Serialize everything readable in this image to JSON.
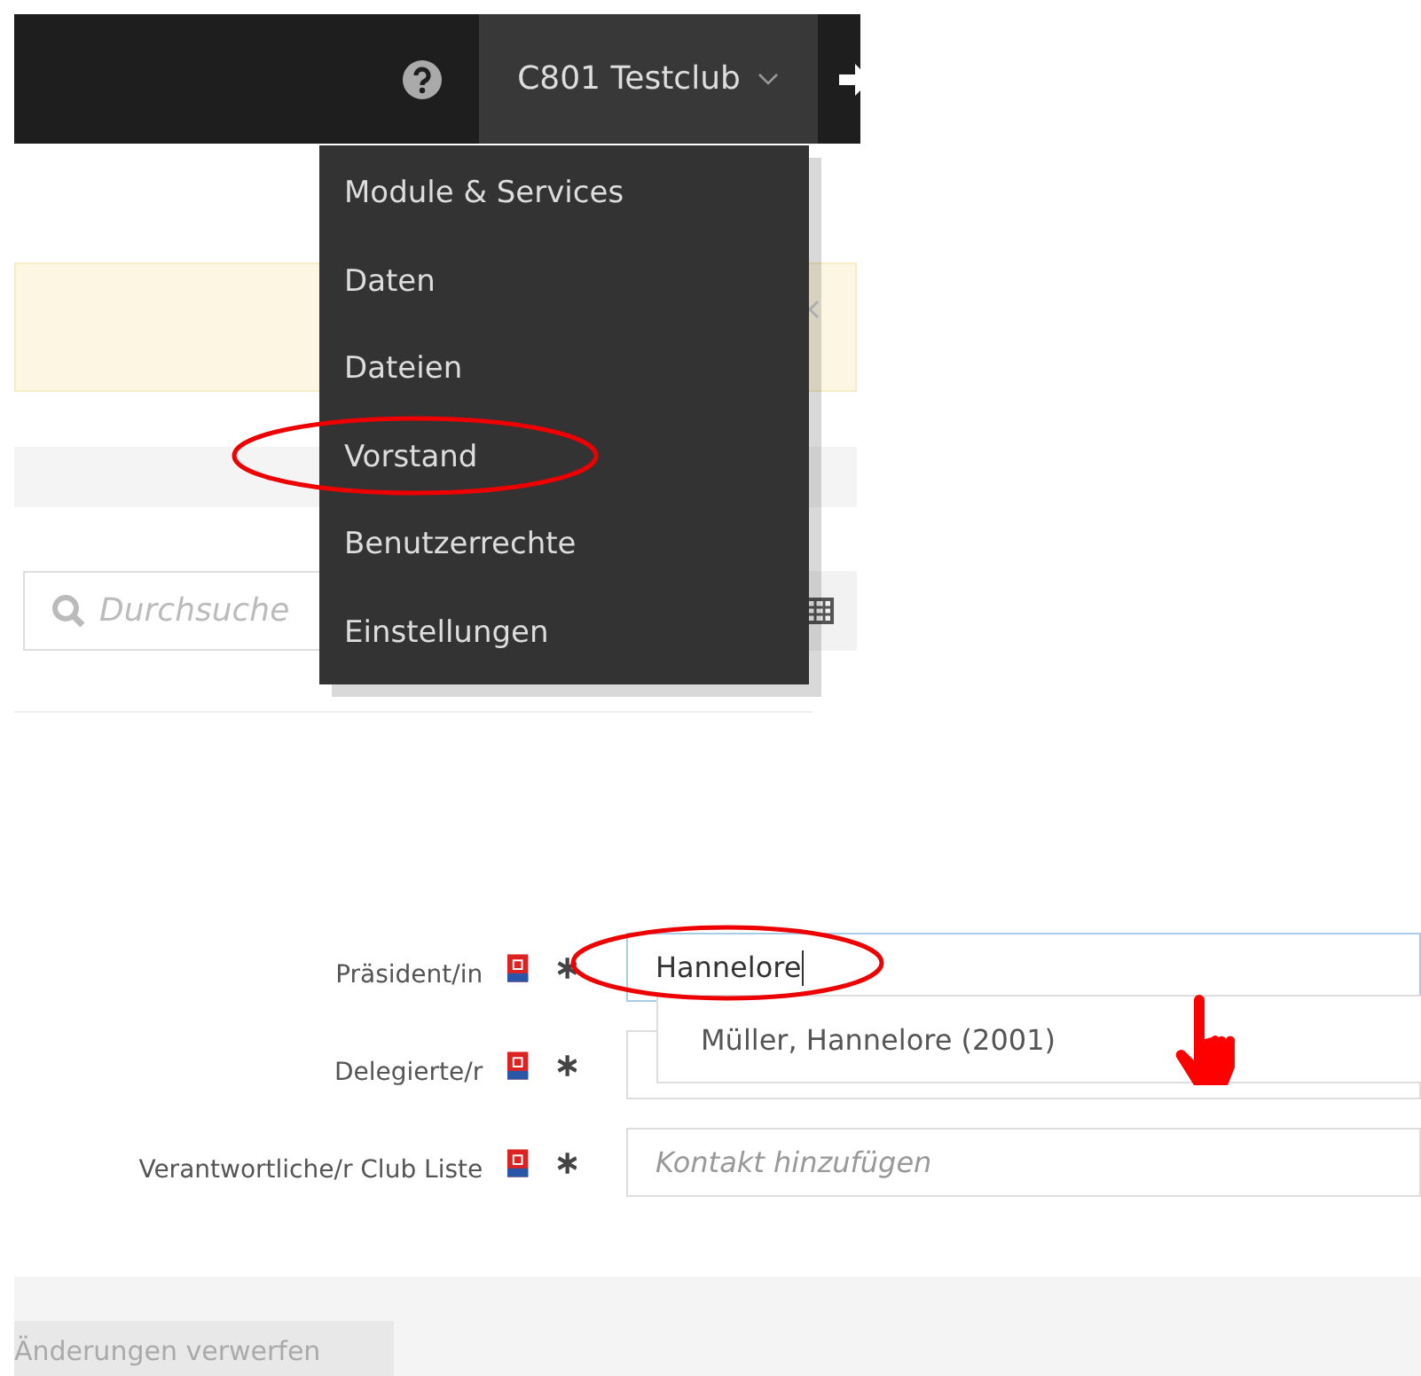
{
  "topbar": {
    "club": "C801 Testclub"
  },
  "club_menu": {
    "items": [
      {
        "label": "Module & Services"
      },
      {
        "label": "Daten"
      },
      {
        "label": "Dateien"
      },
      {
        "label": "Vorstand"
      },
      {
        "label": "Benutzerrechte"
      },
      {
        "label": "Einstellungen"
      }
    ]
  },
  "search": {
    "placeholder": "Durchsuche"
  },
  "form": {
    "rows": [
      {
        "label": "Präsident/in",
        "required": true,
        "value": "Hannelore",
        "focused": true
      },
      {
        "label": "Delegierte/r",
        "required": true,
        "focused": false
      },
      {
        "label": "Verantwortliche/r Club Liste",
        "required": true,
        "placeholder": "Kontakt hinzufügen",
        "focused": false
      }
    ],
    "suggestions": [
      "Müller, Hannelore (2001)"
    ]
  },
  "footer": {
    "buttons": [
      "Änderungen verwerfen"
    ]
  }
}
